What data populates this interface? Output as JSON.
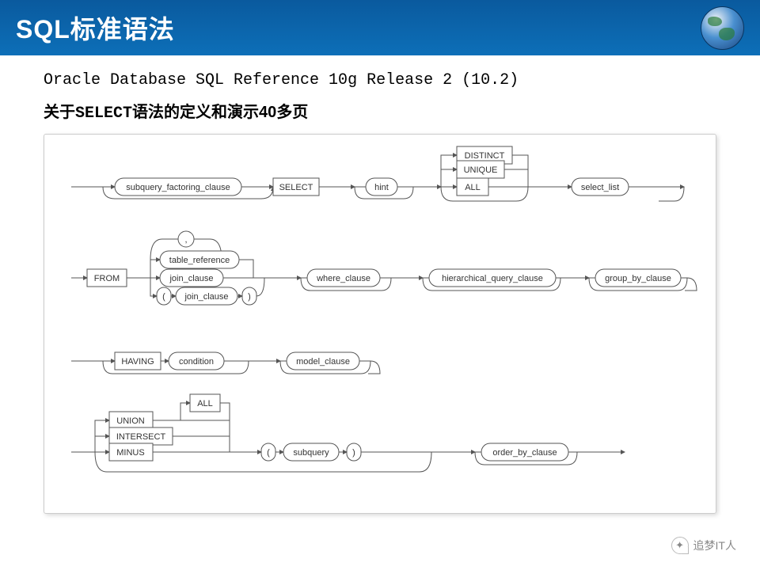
{
  "header": {
    "title": "SQL标准语法"
  },
  "content": {
    "reference": "Oracle Database SQL Reference 10g Release 2 (10.2)",
    "subtitle_pre": "关于",
    "subtitle_mono": "SELECT",
    "subtitle_post": "语法的定义和演示40多页"
  },
  "diagram": {
    "row1": {
      "subquery_factoring": "subquery_factoring_clause",
      "select": "SELECT",
      "hint": "hint",
      "distinct": "DISTINCT",
      "unique": "UNIQUE",
      "all": "ALL",
      "select_list": "select_list"
    },
    "row2": {
      "from": "FROM",
      "comma": ",",
      "table_reference": "table_reference",
      "join_clause": "join_clause",
      "lp": "(",
      "rp": ")",
      "where_clause": "where_clause",
      "hier": "hierarchical_query_clause",
      "group_by": "group_by_clause"
    },
    "row3": {
      "having": "HAVING",
      "condition": "condition",
      "model": "model_clause"
    },
    "row4": {
      "all": "ALL",
      "union": "UNION",
      "intersect": "INTERSECT",
      "minus": "MINUS",
      "lp": "(",
      "subquery": "subquery",
      "rp": ")",
      "order_by": "order_by_clause"
    }
  },
  "watermark": "追梦IT人"
}
